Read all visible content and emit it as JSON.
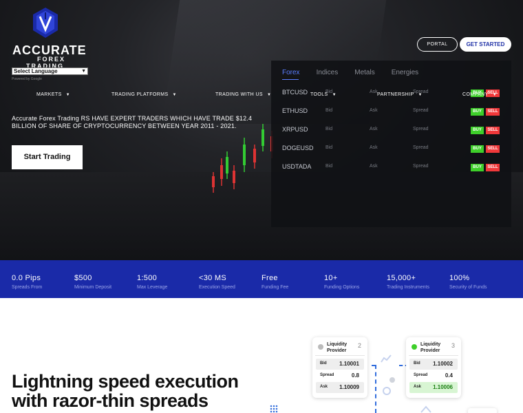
{
  "brand": {
    "line1": "ACCURATE",
    "line2": "FOREX",
    "line3": "TRADING",
    "logo_icon": "shield-v-icon"
  },
  "language": {
    "selected": "Select Language",
    "powered_by": "Powered by Google"
  },
  "header_buttons": {
    "portal": "PORTAL",
    "get_started": "GET STARTED"
  },
  "nav": {
    "markets": "MARKETS",
    "platforms": "TRADING PLATFORMS",
    "with_us": "TRADING WITH US",
    "tools": "TOOLS",
    "partnership": "PARTNERSHIP",
    "company": "COMPANY"
  },
  "hero": {
    "text": "Accurate Forex Trading RS HAVE EXPERT TRADERS WHICH HAVE TRADE $12.4 BILLION OF SHARE OF CRYPTOCURRENCY BETWEEN YEAR 2011 - 2021.",
    "cta": "Start Trading"
  },
  "panel": {
    "tabs": [
      "Forex",
      "Indices",
      "Metals",
      "Energies"
    ],
    "active_tab": "Forex",
    "rows": [
      {
        "symbol": "BTCUSD",
        "bid": "Bid",
        "ask": "Ask",
        "spread": "Spread",
        "buy": "BUY",
        "sell": "SELL"
      },
      {
        "symbol": "ETHUSD",
        "bid": "Bid",
        "ask": "Ask",
        "spread": "Spread",
        "buy": "BUY",
        "sell": "SELL"
      },
      {
        "symbol": "XRPUSD",
        "bid": "Bid",
        "ask": "Ask",
        "spread": "Spread",
        "buy": "BUY",
        "sell": "SELL"
      },
      {
        "symbol": "DOGEUSD",
        "bid": "Bid",
        "ask": "Ask",
        "spread": "Spread",
        "buy": "BUY",
        "sell": "SELL"
      },
      {
        "symbol": "USDTADA",
        "bid": "Bid",
        "ask": "Ask",
        "spread": "Spread",
        "buy": "BUY",
        "sell": "SELL"
      }
    ]
  },
  "stats": [
    {
      "value": "0.0 Pips",
      "label": "Spreads From"
    },
    {
      "value": "$500",
      "label": "Minimum Deposit"
    },
    {
      "value": "1:500",
      "label": "Max Leverage"
    },
    {
      "value": "<30 MS",
      "label": "Execution Speed"
    },
    {
      "value": "Free",
      "label": "Funding Fee"
    },
    {
      "value": "10+",
      "label": "Funding Options"
    },
    {
      "value": "15,000+",
      "label": "Trading Instruments"
    },
    {
      "value": "100%",
      "label": "Security of Funds"
    }
  ],
  "feature": {
    "heading_line1": "Lightning speed execution",
    "heading_line2": "with razor-thin spreads"
  },
  "providers": [
    {
      "title_1": "Liquidity",
      "title_2": "Provider",
      "number": "2",
      "bid_label": "Bid",
      "bid": "1.10001",
      "spread_label": "Spread",
      "spread": "0.8",
      "ask_label": "Ask",
      "ask": "1.10009",
      "status_color": "#bbbbbb"
    },
    {
      "title_1": "Liquidity",
      "title_2": "Provider",
      "number": "3",
      "bid_label": "Bid",
      "bid": "1.10002",
      "spread_label": "Spread",
      "spread": "0.4",
      "ask_label": "Ask",
      "ask": "1.10006",
      "status_color": "#3ecf2a"
    }
  ],
  "colors": {
    "accent": "#1a2aa8",
    "buy": "#3ecf2a",
    "sell": "#f0383a",
    "tab_active": "#5a7dff"
  }
}
